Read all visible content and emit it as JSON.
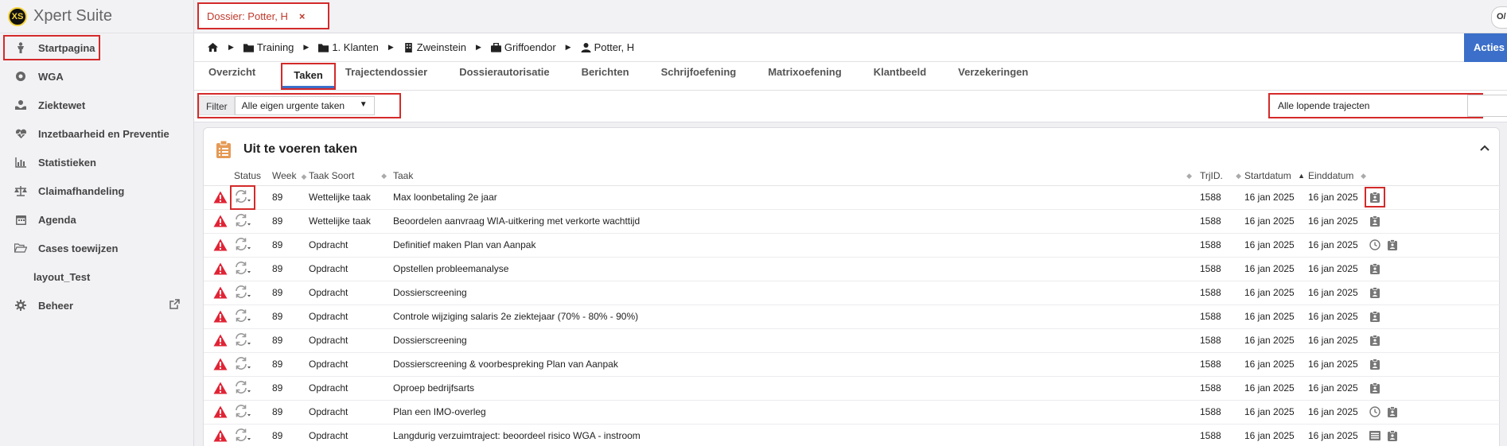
{
  "app": {
    "name": "Xpert Suite",
    "logo": "XS"
  },
  "top": {
    "dossier_tab": "Dossier: Potter, H",
    "close": "×",
    "user": "O/"
  },
  "sidebar": {
    "items": [
      {
        "label": "Startpagina",
        "icon": "home-person-icon"
      },
      {
        "label": "WGA",
        "icon": "gear-badge-icon"
      },
      {
        "label": "Ziektewet",
        "icon": "hands-icon"
      },
      {
        "label": "Inzetbaarheid en Preventie",
        "icon": "heartbeat-icon"
      },
      {
        "label": "Statistieken",
        "icon": "chart-icon"
      },
      {
        "label": "Claimafhandeling",
        "icon": "scale-icon"
      },
      {
        "label": "Agenda",
        "icon": "calendar-icon"
      },
      {
        "label": "Cases toewijzen",
        "icon": "folder-open-icon"
      },
      {
        "label": "layout_Test",
        "icon": ""
      },
      {
        "label": "Beheer",
        "icon": "cog-icon"
      }
    ]
  },
  "breadcrumb": [
    "Training",
    "1. Klanten",
    "Zweinstein",
    "Griffoendor",
    "Potter, H"
  ],
  "acties": "Acties",
  "tabs": [
    "Overzicht",
    "Taken",
    "Trajectendossier",
    "Dossierautorisatie",
    "Berichten",
    "Schrijfoefening",
    "Matrixoefening",
    "Klantbeeld",
    "Verzekeringen"
  ],
  "filter": {
    "label": "Filter",
    "value": "Alle eigen urgente taken",
    "trajecten": "Alle lopende trajecten"
  },
  "card": {
    "title": "Uit te voeren taken"
  },
  "columns": {
    "status": "Status",
    "week": "Week",
    "soort": "Taak Soort",
    "taak": "Taak",
    "trj": "TrjID.",
    "start": "Startdatum",
    "eind": "Einddatum"
  },
  "rows": [
    {
      "week": "89",
      "soort": "Wettelijke taak",
      "taak": "Max loonbetaling 2e jaar",
      "trj": "1588",
      "start": "16 jan 2025",
      "eind": "16 jan 2025",
      "icons": [
        "clipboard-icon"
      ]
    },
    {
      "week": "89",
      "soort": "Wettelijke taak",
      "taak": "Beoordelen aanvraag WIA-uitkering met verkorte wachttijd",
      "trj": "1588",
      "start": "16 jan 2025",
      "eind": "16 jan 2025",
      "icons": [
        "clipboard-icon"
      ]
    },
    {
      "week": "89",
      "soort": "Opdracht",
      "taak": "Definitief maken Plan van Aanpak",
      "trj": "1588",
      "start": "16 jan 2025",
      "eind": "16 jan 2025",
      "icons": [
        "clock-icon",
        "clipboard-icon"
      ]
    },
    {
      "week": "89",
      "soort": "Opdracht",
      "taak": "Opstellen probleemanalyse",
      "trj": "1588",
      "start": "16 jan 2025",
      "eind": "16 jan 2025",
      "icons": [
        "clipboard-icon"
      ]
    },
    {
      "week": "89",
      "soort": "Opdracht",
      "taak": "Dossierscreening",
      "trj": "1588",
      "start": "16 jan 2025",
      "eind": "16 jan 2025",
      "icons": [
        "clipboard-icon"
      ]
    },
    {
      "week": "89",
      "soort": "Opdracht",
      "taak": "Controle wijziging salaris 2e ziektejaar (70% - 80% - 90%)",
      "trj": "1588",
      "start": "16 jan 2025",
      "eind": "16 jan 2025",
      "icons": [
        "clipboard-icon"
      ]
    },
    {
      "week": "89",
      "soort": "Opdracht",
      "taak": "Dossierscreening",
      "trj": "1588",
      "start": "16 jan 2025",
      "eind": "16 jan 2025",
      "icons": [
        "clipboard-icon"
      ]
    },
    {
      "week": "89",
      "soort": "Opdracht",
      "taak": "Dossierscreening & voorbespreking Plan van Aanpak",
      "trj": "1588",
      "start": "16 jan 2025",
      "eind": "16 jan 2025",
      "icons": [
        "clipboard-icon"
      ]
    },
    {
      "week": "89",
      "soort": "Opdracht",
      "taak": "Oproep bedrijfsarts",
      "trj": "1588",
      "start": "16 jan 2025",
      "eind": "16 jan 2025",
      "icons": [
        "clipboard-icon"
      ]
    },
    {
      "week": "89",
      "soort": "Opdracht",
      "taak": "Plan een IMO-overleg",
      "trj": "1588",
      "start": "16 jan 2025",
      "eind": "16 jan 2025",
      "icons": [
        "clock-icon",
        "clipboard-icon"
      ]
    },
    {
      "week": "89",
      "soort": "Opdracht",
      "taak": "Langdurig verzuimtraject: beoordeel risico WGA - instroom",
      "trj": "1588",
      "start": "16 jan 2025",
      "eind": "16 jan 2025",
      "icons": [
        "list-icon",
        "clipboard-icon"
      ]
    }
  ],
  "colors": {
    "accent": "#3b6fc9",
    "warning": "#e02435",
    "highlight": "#d42a2a",
    "task_icon": "#e59a56"
  }
}
